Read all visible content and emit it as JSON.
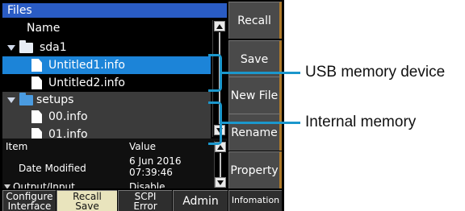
{
  "panel": {
    "title": "Files",
    "name_header": "Name"
  },
  "files": [
    {
      "label": "sda1",
      "kind": "folder",
      "state": "expanded"
    },
    {
      "label": "Untitled1.info",
      "kind": "file",
      "state": "selected"
    },
    {
      "label": "Untitled2.info",
      "kind": "file"
    },
    {
      "label": "setups",
      "kind": "folder",
      "state": "expanded"
    },
    {
      "label": "00.info",
      "kind": "file"
    },
    {
      "label": "01.info",
      "kind": "file"
    }
  ],
  "properties": {
    "headers": {
      "item": "Item",
      "value": "Value"
    },
    "rows": [
      {
        "item": "Date Modified",
        "value_line1": "6 Jun 2016",
        "value_line2": "07:39:46"
      },
      {
        "item": "Output/Input",
        "value_line1": "Disable"
      }
    ]
  },
  "side_buttons": [
    "Recall",
    "Save",
    "New File",
    "Rename",
    "Property"
  ],
  "tabs": [
    {
      "line1": "Configure",
      "line2": "Interface"
    },
    {
      "line1": "Recall",
      "line2": "Save",
      "active": true
    },
    {
      "line1": "SCPI",
      "line2": "Error"
    },
    {
      "line1": "Admin"
    },
    {
      "line1": "Infomation"
    }
  ],
  "annotations": {
    "usb": "USB memory device",
    "internal": "Internal memory"
  },
  "colors": {
    "title_bar": "#2a5cc4",
    "selection": "#1c84d8",
    "callout": "#1b97cc",
    "active_tab": "#e9e4bd",
    "button_edge": "#b07b2b"
  }
}
